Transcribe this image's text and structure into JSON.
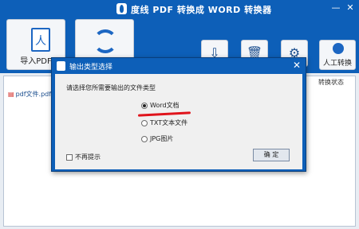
{
  "app": {
    "title": "度线 PDF 转换成 WORD 转换器",
    "min_label": "—",
    "close_label": "✕"
  },
  "toolbar": {
    "import_label": "导入PDF",
    "person_label": "人工转换"
  },
  "file_list": {
    "column_header": "转换状态",
    "rows": [
      {
        "name": "pdf文件.pdf"
      }
    ]
  },
  "dialog": {
    "title": "输出类型选择",
    "close_label": "✕",
    "prompt": "请选择您所需要输出的文件类型",
    "options": [
      {
        "label": "Word文档",
        "selected": true
      },
      {
        "label": "TXT文本文件",
        "selected": false
      },
      {
        "label": "JPG图片",
        "selected": false
      }
    ],
    "checkbox_label": "不再提示",
    "ok_label": "确 定"
  },
  "colors": {
    "brand": "#0d5fb8",
    "annotation": "#e0141c"
  }
}
